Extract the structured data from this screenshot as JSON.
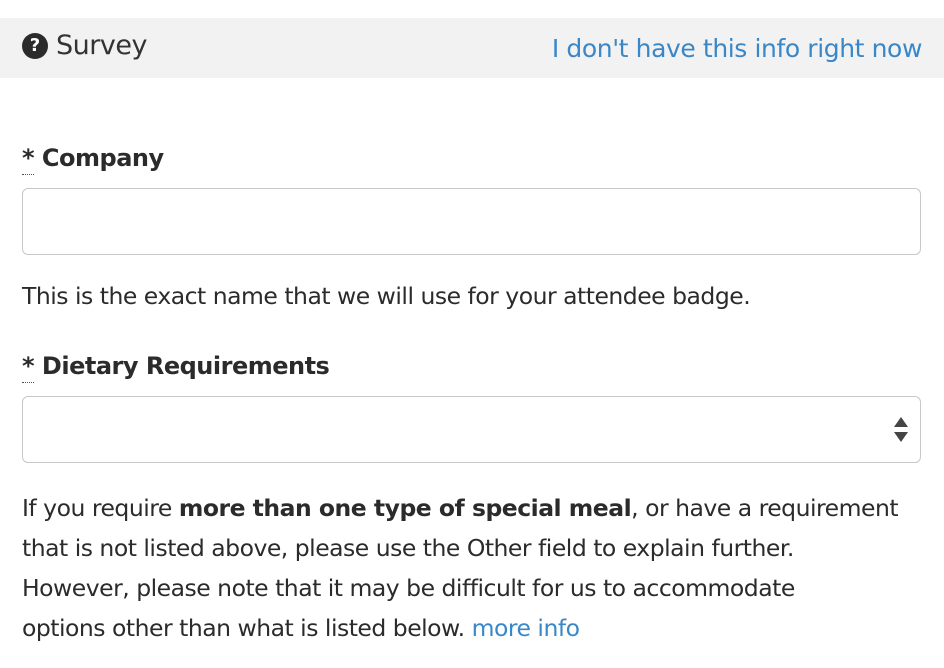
{
  "header": {
    "icon": "question-circle-icon",
    "title": "Survey",
    "skip_link": "I don't have this info right now"
  },
  "fields": {
    "company": {
      "required_marker": "*",
      "label": "Company",
      "value": "",
      "help": "This is the exact name that we will use for your attendee badge."
    },
    "dietary": {
      "required_marker": "*",
      "label": "Dietary Requirements",
      "selected": "",
      "help_line1_pre": "If you require ",
      "help_line1_bold": "more than one type of special meal",
      "help_line1_post": ", or have a requirement",
      "help_line2": "that is not listed above, please use the Other field to explain further.",
      "help_line3": "However, please note that it may be difficult for us to accommodate",
      "help_line4": "options other than what is listed below.",
      "more_info_link": "more info"
    }
  },
  "colors": {
    "link": "#3a87c8",
    "header_bg": "#f2f2f2",
    "text": "#2b2b2b"
  }
}
